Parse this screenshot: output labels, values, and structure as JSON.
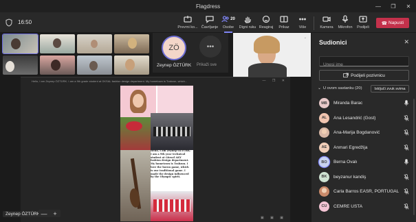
{
  "window": {
    "title": "Flagdress",
    "controls": [
      "—",
      "❐",
      "✕"
    ]
  },
  "toolbar": {
    "timer": "16:50",
    "buttons": [
      {
        "label": "Prevrni ko...",
        "icon": "share-tray-icon"
      },
      {
        "label": "Čavrljanje",
        "icon": "chat-icon"
      },
      {
        "label": "Osobe",
        "icon": "people-icon",
        "badge": "20",
        "active": true
      },
      {
        "label": "Digni ruku",
        "icon": "raise-hand-icon"
      },
      {
        "label": "Reagiraj",
        "icon": "react-icon"
      },
      {
        "label": "Prikaz",
        "icon": "view-icon"
      },
      {
        "label": "Više",
        "icon": "more-icon"
      },
      {
        "label": "Kamera",
        "icon": "camera-icon"
      },
      {
        "label": "Mikrofon",
        "icon": "microphone-icon"
      },
      {
        "label": "Podijeli",
        "icon": "share-icon"
      }
    ],
    "leave_label": "Napusti"
  },
  "stage": {
    "avatar_initials": "ZÖ",
    "avatar_name": "Zeynep ÖZTÜRK",
    "more_label": "Prikaži sve",
    "more_icon": "ellipsis-icon",
    "presenter_name": "Zeynep ÖZTÜRK",
    "zoom_minus": "—",
    "zoom_plus": "+",
    "share_caption": "Hello, I am Zeynep ÖZTÜRK. I am a 9th grade student at GKSAL fashion design department. My hometown is Trabzon, which...",
    "poster_text": "Hello, I am Zeynep ÖZTÜRK. I am a 9th year technical student at Gürsel AKY fashion design department. My hometown is Trabzon. I love the horon game, which is our traditional game. I made the design influenced by the Olympic spirit."
  },
  "panel": {
    "title": "Sudionici",
    "search_placeholder": "Unesi ime",
    "invite_label": "Podijeli pozivnicu",
    "section_label": "U ovom sastanku (20)",
    "mute_all_label": "Isključi zvuk svima",
    "participants": [
      {
        "initials": "MB",
        "name": "Miranda Barac",
        "color": "#e8c9c9",
        "mic": "on"
      },
      {
        "initials": "AL",
        "name": "Ana Lesandrić (Gost)",
        "color": "#f1c5b0",
        "mic": "off"
      },
      {
        "initials": "",
        "name": "Ana-Marija Bogdanović",
        "color": "#d9b8a6",
        "mic": "off",
        "photo": true
      },
      {
        "initials": "AE",
        "name": "Anmari Egredžija",
        "color": "#f0cdb8",
        "mic": "off"
      },
      {
        "initials": "BO",
        "name": "Berna Ovalı",
        "color": "#c8d2f0",
        "mic": "on",
        "ring": true
      },
      {
        "initials": "BK",
        "name": "beyzanur kandiş",
        "color": "#cfe3d3",
        "mic": "off"
      },
      {
        "initials": "",
        "name": "Carla Barros EASR, PORTUGAL",
        "color": "#c98a6a",
        "mic": "off",
        "photo": true
      },
      {
        "initials": "CU",
        "name": "CEMRE USTA",
        "color": "#f4c4d4",
        "mic": "off"
      }
    ]
  },
  "colors": {
    "accent": "#7f85f5",
    "leave": "#c4314b",
    "panel_bg": "#292929"
  }
}
